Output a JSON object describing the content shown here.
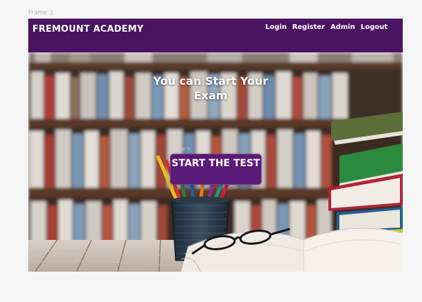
{
  "canvas": {
    "frame_label": "Frame 3",
    "sub_frame_label": "Frame 4"
  },
  "navbar": {
    "brand": "FREMOUNT ACADEMY",
    "links": [
      {
        "label": "Login"
      },
      {
        "label": "Register"
      },
      {
        "label": "Admin"
      },
      {
        "label": "Logout"
      }
    ],
    "background": "#4b1463"
  },
  "hero": {
    "title": "You can Start Your Exam",
    "button_label": "START THE TEST",
    "button_color": "#5a1a77"
  }
}
